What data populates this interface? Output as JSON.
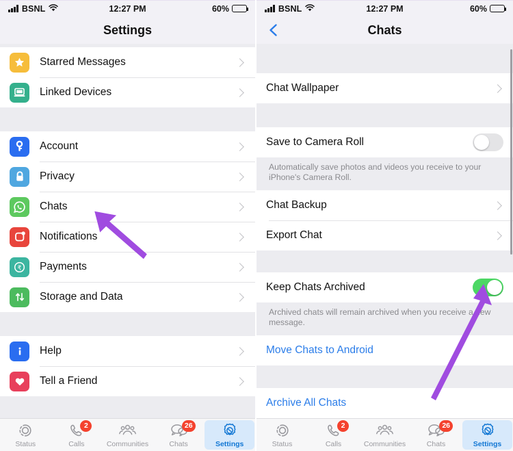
{
  "status_bar": {
    "carrier": "BSNL",
    "time": "12:27 PM",
    "battery_text": "60%",
    "battery_level": 60,
    "signal_icon": "signal-bars-icon",
    "wifi_icon": "wifi-icon"
  },
  "colors": {
    "accent_blue": "#2b7de9",
    "toggle_on_green": "#4cd764",
    "badge_red": "#f4422e",
    "arrow_purple": "#a04ce0",
    "group_bg": "#ececf0",
    "active_tab_bg": "#d7e9fb"
  },
  "left_screen": {
    "nav": {
      "title": "Settings"
    },
    "sections": [
      {
        "rows": [
          {
            "label": "Starred Messages",
            "icon": "star-icon",
            "icon_bg": "#f6bd3b",
            "accessory": "chevron"
          },
          {
            "label": "Linked Devices",
            "icon": "laptop-icon",
            "icon_bg": "#34b08c",
            "accessory": "chevron"
          }
        ]
      },
      {
        "rows": [
          {
            "label": "Account",
            "icon": "key-icon",
            "icon_bg": "#2a6df0",
            "accessory": "chevron"
          },
          {
            "label": "Privacy",
            "icon": "lock-icon",
            "icon_bg": "#4fa7e0",
            "accessory": "chevron"
          },
          {
            "label": "Chats",
            "icon": "whatsapp-bubble-icon",
            "icon_bg": "#5dc95f",
            "accessory": "chevron"
          },
          {
            "label": "Notifications",
            "icon": "notification-icon",
            "icon_bg": "#e8453c",
            "accessory": "chevron"
          },
          {
            "label": "Payments",
            "icon": "rupee-circle-icon",
            "icon_bg": "#3cb5a0",
            "accessory": "chevron"
          },
          {
            "label": "Storage and Data",
            "icon": "arrows-updown-icon",
            "icon_bg": "#4cbb5e",
            "accessory": "chevron"
          }
        ]
      },
      {
        "rows": [
          {
            "label": "Help",
            "icon": "info-icon",
            "icon_bg": "#2a6df0",
            "accessory": "chevron"
          },
          {
            "label": "Tell a Friend",
            "icon": "heart-icon",
            "icon_bg": "#e8405c",
            "accessory": "chevron"
          }
        ]
      }
    ],
    "annotation_arrow": {
      "name": "arrow-pointing-to-chats",
      "color": "#a04ce0"
    }
  },
  "right_screen": {
    "nav": {
      "title": "Chats",
      "back_icon": "chevron-left-icon"
    },
    "rows": [
      {
        "label": "Chat Wallpaper",
        "accessory": "chevron"
      },
      {
        "label": "Save to Camera Roll",
        "accessory": "toggle",
        "toggle_on": false
      },
      {
        "label": "Chat Backup",
        "accessory": "chevron"
      },
      {
        "label": "Export Chat",
        "accessory": "chevron"
      },
      {
        "label": "Keep Chats Archived",
        "accessory": "toggle",
        "toggle_on": true
      },
      {
        "label": "Move Chats to Android",
        "accessory": "none",
        "style": "blue"
      },
      {
        "label": "Archive All Chats",
        "accessory": "none",
        "style": "blue"
      }
    ],
    "footnotes": {
      "camera_roll": "Automatically save photos and videos you receive to your iPhone's Camera Roll.",
      "keep_archived": "Archived chats will remain archived when you receive a new message."
    },
    "annotation_arrow": {
      "name": "arrow-pointing-to-keep-chats-archived-toggle",
      "color": "#a04ce0"
    }
  },
  "tab_bar": {
    "tabs": [
      {
        "label": "Status",
        "icon": "status-rings-icon",
        "badge": "",
        "active": false
      },
      {
        "label": "Calls",
        "icon": "phone-icon",
        "badge": "2",
        "active": false
      },
      {
        "label": "Communities",
        "icon": "communities-icon",
        "badge": "",
        "active": false
      },
      {
        "label": "Chats",
        "icon": "chat-bubbles-icon",
        "badge": "26",
        "active": false
      },
      {
        "label": "Settings",
        "icon": "gear-icon",
        "badge": "",
        "active": true
      }
    ]
  }
}
